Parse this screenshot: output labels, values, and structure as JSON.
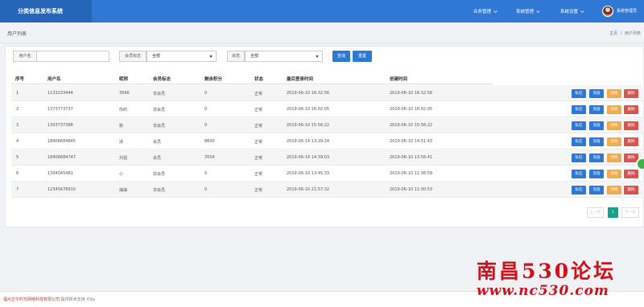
{
  "app": {
    "title": "分类信息发布系统"
  },
  "topnav": {
    "items": [
      {
        "label": "业务管理"
      },
      {
        "label": "系统管理"
      },
      {
        "label": "系统设置"
      }
    ],
    "user": "系统管理员"
  },
  "page": {
    "title": "用户列表"
  },
  "breadcrumb": {
    "home": "主页",
    "sep": "/",
    "current": "用户列表"
  },
  "filters": {
    "username_label": "用户名",
    "username_value": "",
    "member_label": "会员标志",
    "member_value": "全部",
    "status_label": "状态",
    "status_value": "全部",
    "query_button": "查询",
    "reset_button": "重置"
  },
  "table": {
    "columns": [
      "序号",
      "用户名",
      "昵称",
      "会员标志",
      "剩余积分",
      "状态",
      "最后登录时间",
      "创建时间"
    ],
    "rows": [
      {
        "no": "1",
        "username": "1133233444",
        "nickname": "3566",
        "member": "非会员",
        "points": "0",
        "status": "正常",
        "last_login": "2019-06-10 16:32:56",
        "created": "2019-06-10 16:32:56"
      },
      {
        "no": "2",
        "username": "1373773737",
        "nickname": "你的",
        "member": "非会员",
        "points": "0",
        "status": "正常",
        "last_login": "2019-06-10 16:02:05",
        "created": "2019-06-10 16:02:05"
      },
      {
        "no": "3",
        "username": "1303737388",
        "nickname": "默",
        "member": "非会员",
        "points": "0",
        "status": "正常",
        "last_login": "2019-06-10 15:56:22",
        "created": "2019-06-10 15:56:22"
      },
      {
        "no": "4",
        "username": "18906684845",
        "nickname": "淅",
        "member": "会员",
        "points": "8600",
        "status": "正常",
        "last_login": "2019-06-14 13:29:24",
        "created": "2019-06-10 14:51:43"
      },
      {
        "no": "5",
        "username": "18906684747",
        "nickname": "刘强",
        "member": "会员",
        "points": "3554",
        "status": "正常",
        "last_login": "2019-06-14 14:39:03",
        "created": "2019-06-10 13:56:41"
      },
      {
        "no": "6",
        "username": "1304045481",
        "nickname": "小",
        "member": "非会员",
        "points": "0",
        "status": "正常",
        "last_login": "2019-06-10 13:45:33",
        "created": "2019-06-10 11:36:59"
      },
      {
        "no": "7",
        "username": "12345678910",
        "nickname": "抽抽",
        "member": "非会员",
        "points": "0",
        "status": "正常",
        "last_login": "2019-06-10 21:57:32",
        "created": "2019-06-10 11:30:53"
      }
    ],
    "actions": {
      "edit": "私信",
      "charge": "充值",
      "ban": "封停",
      "delete": "删除"
    }
  },
  "pagination": {
    "prev": "上一页",
    "current": "1",
    "next": "下一页"
  },
  "footer": {
    "company": "福州正午时光网络科技有限公司",
    "support": " 提供技术支持 ©by"
  },
  "watermark": {
    "title": "南昌530论坛",
    "url": "www.nc530.com"
  },
  "colors": {
    "primary": "#2f78d3",
    "brand_bg": "#2566b8",
    "warning": "#f0ad4e",
    "danger": "#d9534f",
    "pager_active": "#18a08c",
    "watermark": "#d0101b"
  }
}
